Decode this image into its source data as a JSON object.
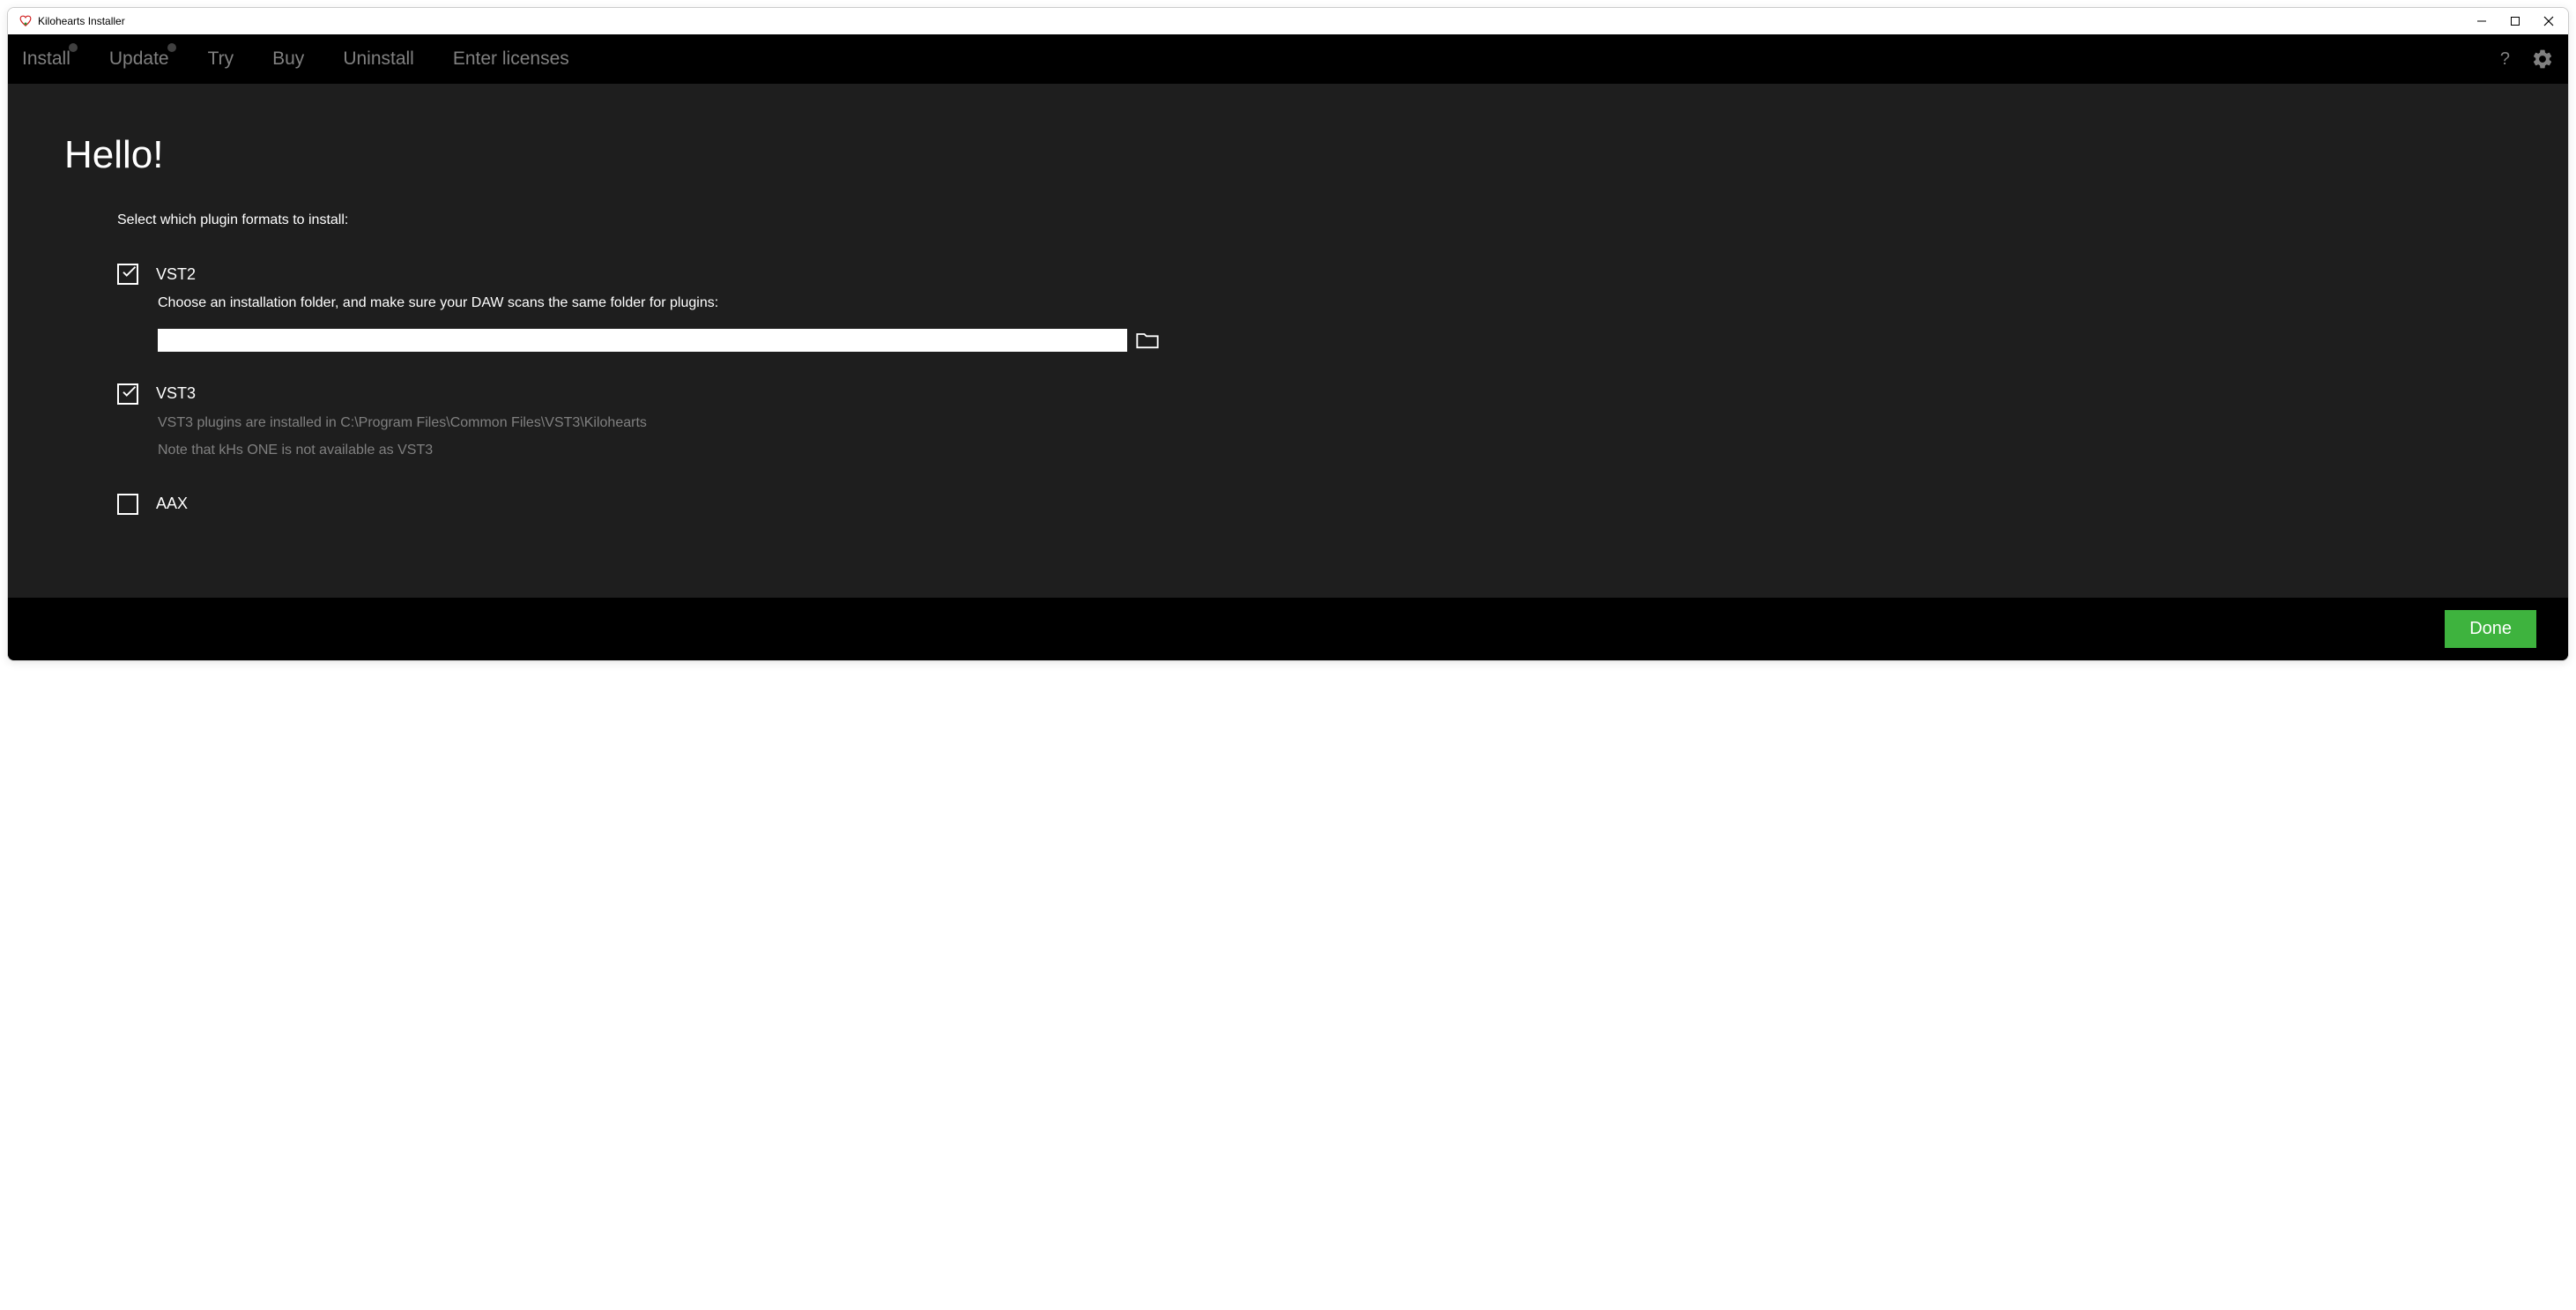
{
  "window": {
    "title": "Kilohearts Installer"
  },
  "nav": {
    "install": "Install",
    "update": "Update",
    "try": "Try",
    "buy": "Buy",
    "uninstall": "Uninstall",
    "licenses": "Enter licenses",
    "help": "?"
  },
  "main": {
    "title": "Hello!",
    "subtitle": "Select which plugin formats to install:",
    "vst2": {
      "label": "VST2",
      "desc": "Choose an installation folder, and make sure your DAW scans the same folder for plugins:",
      "path": "",
      "checked": true
    },
    "vst3": {
      "label": "VST3",
      "desc1": "VST3 plugins are installed in C:\\Program Files\\Common Files\\VST3\\Kilohearts",
      "desc2": "Note that kHs ONE is not available as VST3",
      "checked": true
    },
    "aax": {
      "label": "AAX",
      "checked": false
    }
  },
  "footer": {
    "done": "Done"
  }
}
